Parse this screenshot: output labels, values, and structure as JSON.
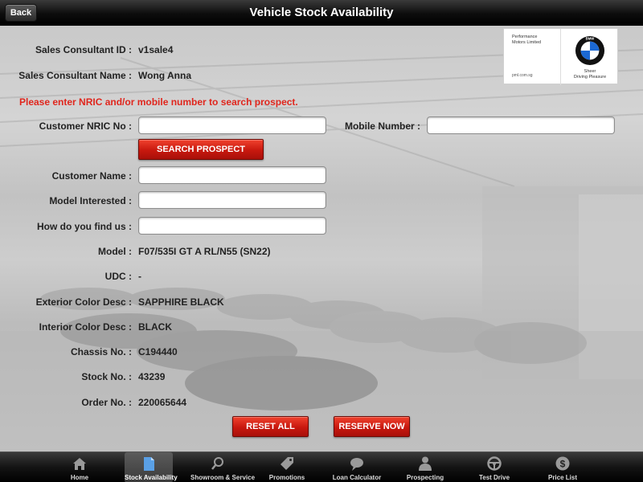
{
  "header": {
    "back_label": "Back",
    "title": "Vehicle Stock Availability"
  },
  "logo": {
    "dealer_name_line1": "Performance",
    "dealer_name_line2": "Motors Limited",
    "dealer_url": "pml.com.sg",
    "brand_letters": "BMW",
    "tagline_line1": "Sheer",
    "tagline_line2": "Driving Pleasure"
  },
  "consultant": {
    "id_label": "Sales Consultant ID :",
    "id_value": "v1sale4",
    "name_label": "Sales Consultant Name :",
    "name_value": "Wong Anna"
  },
  "message": "Please enter NRIC and/or mobile number to search prospect.",
  "search": {
    "nric_label": "Customer NRIC No :",
    "nric_value": "",
    "mobile_label": "Mobile Number :",
    "mobile_value": "",
    "button_label": "SEARCH PROSPECT"
  },
  "customer": {
    "name_label": "Customer Name :",
    "name_value": "",
    "model_interested_label": "Model Interested :",
    "model_interested_value": "",
    "find_us_label": "How do you find us :",
    "find_us_value": ""
  },
  "vehicle": {
    "model_label": "Model :",
    "model_value": "F07/535I GT A RL/N55 (SN22)",
    "udc_label": "UDC :",
    "udc_value": "-",
    "ext_color_label": "Exterior Color Desc :",
    "ext_color_value": "SAPPHIRE BLACK",
    "int_color_label": "Interior Color Desc :",
    "int_color_value": "BLACK",
    "chassis_label": "Chassis No. :",
    "chassis_value": "C194440",
    "stock_label": "Stock No. :",
    "stock_value": "43239",
    "order_label": "Order No. :",
    "order_value": "220065644"
  },
  "actions": {
    "reset_label": "RESET ALL",
    "reserve_label": "RESERVE NOW"
  },
  "tabs": [
    {
      "label": "Home",
      "icon": "home-icon",
      "active": false
    },
    {
      "label": "Stock Availability",
      "icon": "document-icon",
      "active": true
    },
    {
      "label": "Showroom & Service",
      "icon": "magnifier-icon",
      "active": false
    },
    {
      "label": "Promotions",
      "icon": "tag-icon",
      "active": false
    },
    {
      "label": "Loan Calculator",
      "icon": "speech-bubble-icon",
      "active": false
    },
    {
      "label": "Prospecting",
      "icon": "person-icon",
      "active": false
    },
    {
      "label": "Test Drive",
      "icon": "steering-wheel-icon",
      "active": false
    },
    {
      "label": "Price List",
      "icon": "dollar-icon",
      "active": false
    }
  ],
  "colors": {
    "accent_red": "#e0261d",
    "button_red": "#c8180e",
    "bar_black": "#000000"
  }
}
